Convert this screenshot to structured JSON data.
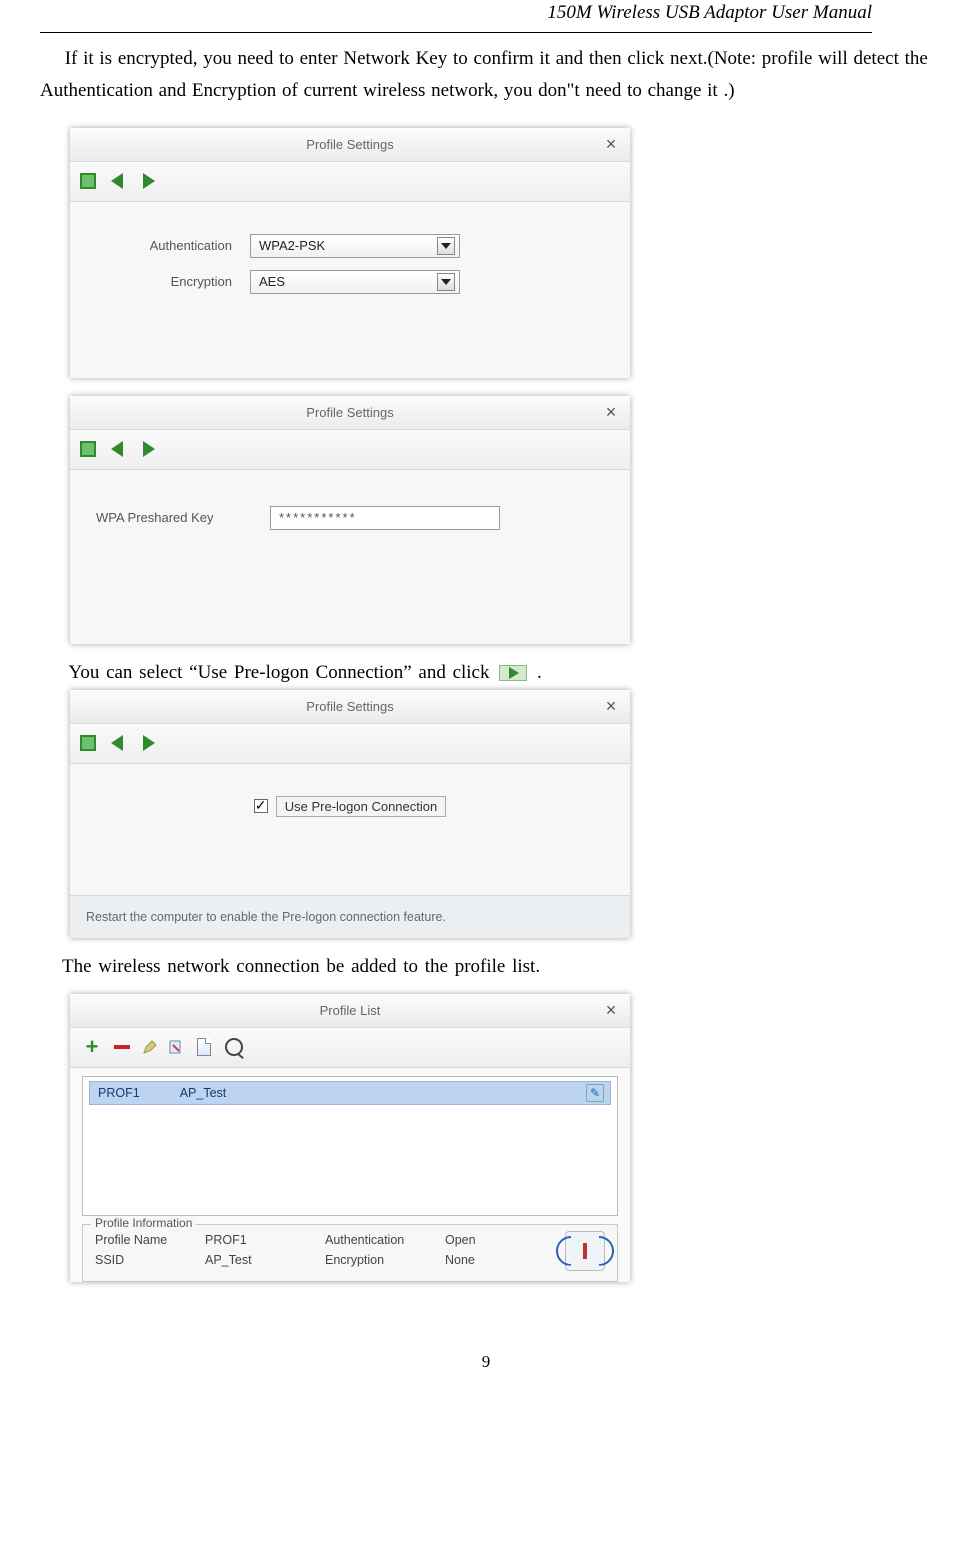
{
  "header": "150M Wireless USB Adaptor User Manual",
  "paragraph1": "If it is encrypted, you need to enter Network Key to confirm it and then click next.(Note: profile will detect the Authentication and Encryption of current wireless network, you don\"t need to change it .)",
  "dlg1": {
    "title": "Profile Settings",
    "lblAuth": "Authentication",
    "lblEnc": "Encryption",
    "valAuth": "WPA2-PSK",
    "valEnc": "AES"
  },
  "dlg2": {
    "title": "Profile Settings",
    "lblKey": "WPA Preshared Key",
    "valKey": "***********"
  },
  "line3a": "You can select “Use Pre-logon Connection” and click ",
  "line3b": ".",
  "dlg3": {
    "title": "Profile Settings",
    "chk": "Use Pre-logon Connection",
    "note": "Restart the computer to enable the Pre-logon connection feature."
  },
  "line4": "The wireless network connection be added to the profile list.",
  "dlg4": {
    "title": "Profile List",
    "row": {
      "name": "PROF1",
      "ssid": "AP_Test"
    },
    "fs_title": "Profile Information",
    "lblProfName": "Profile Name",
    "lblSSID": "SSID",
    "lblAuth": "Authentication",
    "lblEnc": "Encryption",
    "valProfName": "PROF1",
    "valSSID": "AP_Test",
    "valAuth": "Open",
    "valEnc": "None"
  },
  "page_num": "9"
}
